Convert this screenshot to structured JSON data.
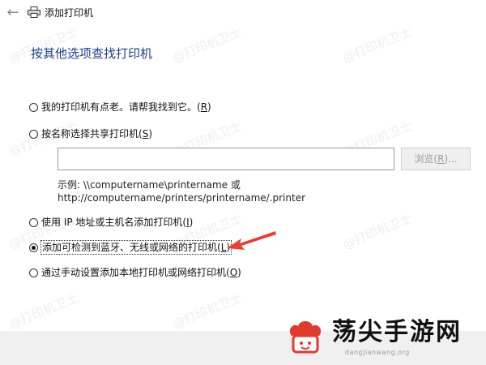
{
  "window": {
    "title": "添加打印机",
    "back_icon": "back-arrow-icon",
    "printer_icon": "printer-icon"
  },
  "heading": "按其他选项查找打印机",
  "options": [
    {
      "label": "我的打印机有点老。请帮我找到它。",
      "shortcut": "R",
      "checked": false
    },
    {
      "label": "按名称选择共享打印机",
      "shortcut": "S",
      "checked": false
    },
    {
      "label": "使用 IP 地址或主机名添加打印机",
      "shortcut": "I",
      "checked": false
    },
    {
      "label": "添加可检测到蓝牙、无线或网络的打印机",
      "shortcut": "L",
      "checked": true
    },
    {
      "label": "通过手动设置添加本地打印机或网络打印机",
      "shortcut": "O",
      "checked": false
    }
  ],
  "shared_name_input": {
    "value": "",
    "placeholder": ""
  },
  "browse_button": {
    "label": "浏览",
    "shortcut": "R",
    "enabled": false
  },
  "example": {
    "line1": "示例: \\\\computername\\printername 或",
    "line2": "http://computername/printers/printername/.printer"
  },
  "watermark": "@打印机卫士",
  "logo": {
    "name": "荡尖手游网",
    "url_text": "dangjianwang.org",
    "colors": {
      "accent": "#e33a2e",
      "arrow": "#ee3b34"
    }
  }
}
